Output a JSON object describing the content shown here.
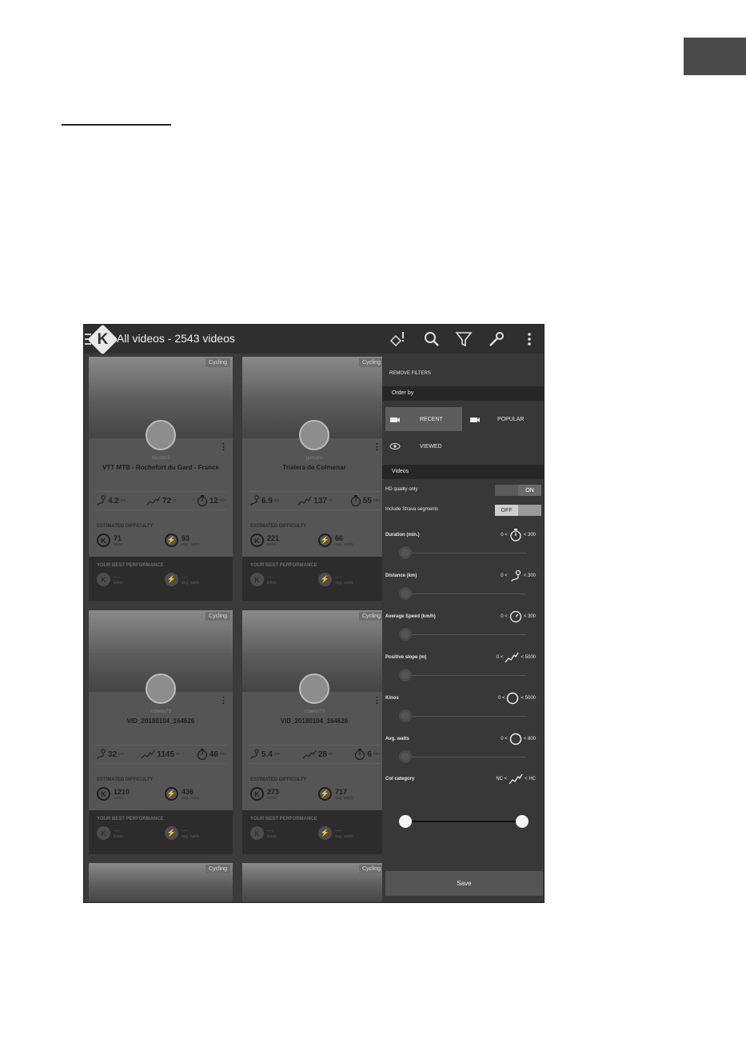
{
  "app": {
    "title": "All videos - 2543 videos"
  },
  "toolbar": {
    "icons": [
      "diamond-alert-icon",
      "search-icon",
      "filter-icon",
      "wrench-icon",
      "more-vert-icon"
    ]
  },
  "cards": [
    {
      "tag": "Cycling",
      "author": "Nicolas3",
      "title": "VTT MTB - Rochefort du Gard - France",
      "distance": "4.2",
      "distance_unit": "km",
      "elevation": "72",
      "elevation_unit": "m",
      "duration": "12",
      "duration_unit": "min",
      "difficulty_label": "ESTIMATED DIFFICULTY",
      "kinos": "71",
      "kinos_unit": "kinos",
      "watts": "93",
      "watts_unit": "avg. watts",
      "best_label": "YOUR BEST PERFORMANCE",
      "best_kinos": "---",
      "best_kinos_unit": "kinos",
      "best_watts": "---",
      "best_watts_unit": "avg. watts"
    },
    {
      "tag": "Cycling",
      "author": "gorcaro",
      "title": "Trialera de Colmenar",
      "distance": "6.9",
      "distance_unit": "km",
      "elevation": "137",
      "elevation_unit": "m",
      "duration": "55",
      "duration_unit": "min",
      "difficulty_label": "ESTIMATED DIFFICULTY",
      "kinos": "221",
      "kinos_unit": "kinos",
      "watts": "66",
      "watts_unit": "avg. watts",
      "best_label": "YOUR BEST PERFORMANCE",
      "best_kinos": "---",
      "best_kinos_unit": "kinos",
      "best_watts": "---",
      "best_watts_unit": "avg. watts"
    },
    {
      "tag": "Cycling",
      "author": "roberto73",
      "title": "VID_20180104_164626",
      "distance": "32",
      "distance_unit": "km",
      "elevation": "1145",
      "elevation_unit": "m",
      "duration": "46",
      "duration_unit": "min",
      "difficulty_label": "ESTIMATED DIFFICULTY",
      "kinos": "1210",
      "kinos_unit": "kinos",
      "watts": "436",
      "watts_unit": "avg. watts",
      "best_label": "YOUR BEST PERFORMANCE",
      "best_kinos": "---",
      "best_kinos_unit": "kinos",
      "best_watts": "---",
      "best_watts_unit": "avg. watts"
    },
    {
      "tag": "Cycling",
      "author": "roberto73",
      "title": "VID_20180104_164626",
      "distance": "5.4",
      "distance_unit": "km",
      "elevation": "28",
      "elevation_unit": "m",
      "duration": "6",
      "duration_unit": "min",
      "difficulty_label": "ESTIMATED DIFFICULTY",
      "kinos": "273",
      "kinos_unit": "kinos",
      "watts": "717",
      "watts_unit": "avg. watts",
      "best_label": "YOUR BEST PERFORMANCE",
      "best_kinos": "---",
      "best_kinos_unit": "kinos",
      "best_watts": "---",
      "best_watts_unit": "avg. watts"
    }
  ],
  "partial_cards": [
    {
      "tag": "Cycling"
    },
    {
      "tag": "Cycling"
    }
  ],
  "filters": {
    "remove": "REMOVE FILTERS",
    "order_by": "Order by",
    "recent": "RECENT",
    "popular": "POPULAR",
    "viewed": "VIEWED",
    "videos": "Videos",
    "hd_label": "HD quality only",
    "hd_state": "ON",
    "strava_label": "Include Strava segments",
    "strava_state": "OFF",
    "duration": {
      "label": "Duration (min.)",
      "min": "0 <",
      "max": "< 300"
    },
    "distance": {
      "label": "Distance (km)",
      "min": "0 <",
      "max": "< 300"
    },
    "speed": {
      "label": "Average Speed (km/h)",
      "min": "0 <",
      "max": "< 300"
    },
    "slope": {
      "label": "Positive slope (m)",
      "min": "0 <",
      "max": "< 5000"
    },
    "kinos": {
      "label": "Kinos",
      "min": "0 <",
      "max": "< 5000"
    },
    "watts": {
      "label": "Avg. watts",
      "min": "0 <",
      "max": "< 800"
    },
    "col": {
      "label": "Col category",
      "min": "NC <",
      "max": "< HC"
    },
    "save": "Save"
  }
}
